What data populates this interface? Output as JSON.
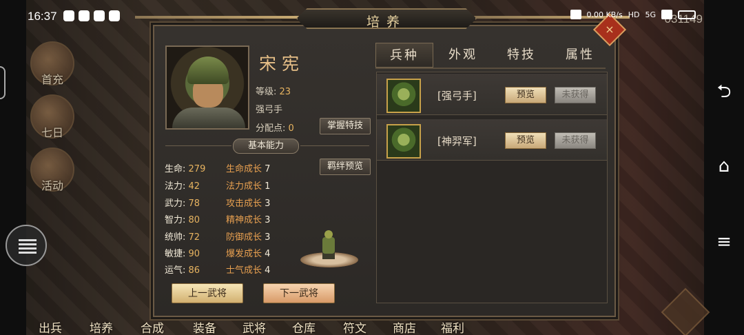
{
  "status_bar": {
    "time": "16:37",
    "net_speed": "0.00 KB/s",
    "hd": "HD",
    "signal": "5G",
    "battery": "",
    "server_id": "031149"
  },
  "side_menu": [
    {
      "label": "首充"
    },
    {
      "label": "七日"
    },
    {
      "label": "活动"
    }
  ],
  "bottom_menu": [
    {
      "label": "出兵"
    },
    {
      "label": "培养"
    },
    {
      "label": "合成"
    },
    {
      "label": "装备"
    },
    {
      "label": "武将"
    },
    {
      "label": "仓库"
    },
    {
      "label": "符文"
    },
    {
      "label": "商店"
    },
    {
      "label": "福利"
    }
  ],
  "panel": {
    "title": "培养",
    "close_label": "×"
  },
  "hero": {
    "name": "宋宪",
    "level_label": "等级:",
    "level": "23",
    "class": "强弓手",
    "points_label": "分配点:",
    "points": "0",
    "master_skill_button": "掌握特技",
    "bond_preview_button": "羁绊预览",
    "section_title": "基本能力",
    "stats": [
      {
        "label": "生命:",
        "value": "279",
        "growth_label": "生命成长",
        "growth": "7"
      },
      {
        "label": "法力:",
        "value": "42",
        "growth_label": "法力成长",
        "growth": "1"
      },
      {
        "label": "武力:",
        "value": "78",
        "growth_label": "攻击成长",
        "growth": "3"
      },
      {
        "label": "智力:",
        "value": "80",
        "growth_label": "精神成长",
        "growth": "3"
      },
      {
        "label": "统帅:",
        "value": "72",
        "growth_label": "防御成长",
        "growth": "3"
      },
      {
        "label": "敏捷:",
        "value": "90",
        "growth_label": "爆发成长",
        "growth": "4"
      },
      {
        "label": "运气:",
        "value": "86",
        "growth_label": "士气成长",
        "growth": "4"
      }
    ],
    "prev_button": "上一武将",
    "next_button": "下一武将"
  },
  "tabs": [
    {
      "label": "兵种",
      "active": true
    },
    {
      "label": "外观",
      "active": false
    },
    {
      "label": "特技",
      "active": false
    },
    {
      "label": "属性",
      "active": false
    }
  ],
  "troop_list": [
    {
      "name": "[强弓手]",
      "preview": "预览",
      "status": "未获得"
    },
    {
      "name": "[神羿军]",
      "preview": "预览",
      "status": "未获得"
    }
  ],
  "nav_icons": [
    "back-icon",
    "home-icon",
    "menu-icon"
  ],
  "colors": {
    "accent_gold": "#e8b460",
    "growth_orange": "#e8a050",
    "icon_border": "#c8a24a"
  }
}
